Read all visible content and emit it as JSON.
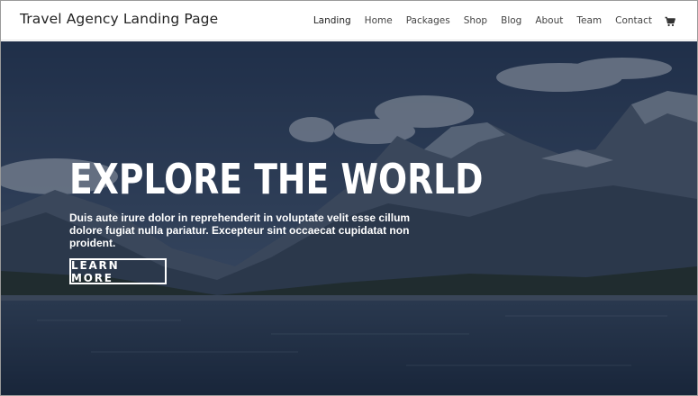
{
  "header": {
    "site_title": "Travel Agency Landing Page",
    "nav": [
      {
        "label": "Landing"
      },
      {
        "label": "Home"
      },
      {
        "label": "Packages"
      },
      {
        "label": "Shop"
      },
      {
        "label": "Blog"
      },
      {
        "label": "About"
      },
      {
        "label": "Team"
      },
      {
        "label": "Contact"
      }
    ],
    "cart_icon": "cart-icon"
  },
  "hero": {
    "title": "EXPLORE THE WORLD",
    "text": "Duis aute irure dolor in reprehenderit in voluptate velit esse cillum dolore fugiat nulla pariatur. Excepteur sint occaecat cupidatat non proident.",
    "button_label": "LEARN MORE",
    "background_image": "mountain-lake-landscape"
  },
  "colors": {
    "header_bg": "#ffffff",
    "hero_overlay": "#142238",
    "text_light": "#ffffff"
  }
}
